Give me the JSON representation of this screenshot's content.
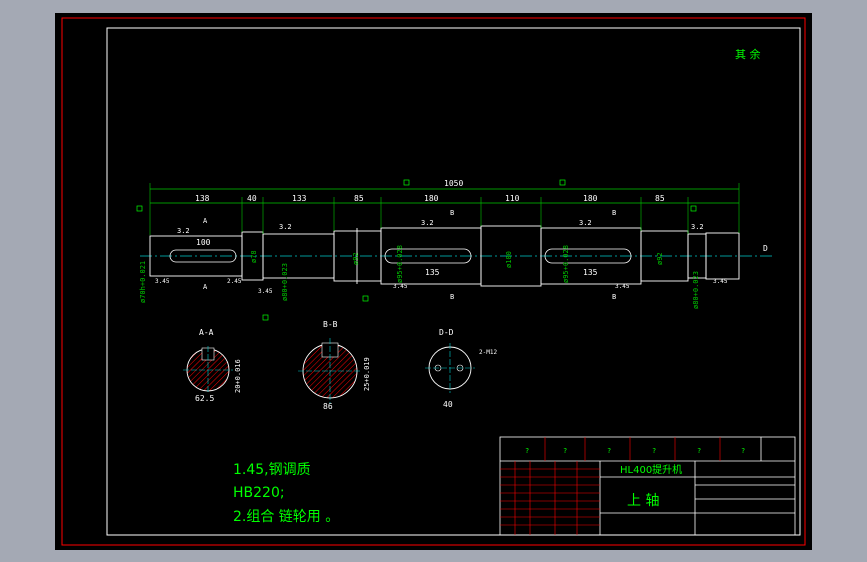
{
  "colors": {
    "background": "#000000",
    "frame": "#ff0000",
    "outline": "#ffffff",
    "dimension": "#00c800",
    "hatch": "#ff0000",
    "centerline": "#00cccc",
    "accent_text": "#00ff00",
    "title_text": "#00ff00"
  },
  "roughness_note": "其 余",
  "overall_length": "1050",
  "dims_top": [
    "138",
    "40",
    "133",
    "85",
    "180",
    "110",
    "180",
    "85"
  ],
  "keyway_lengths": [
    "100",
    "135",
    "135"
  ],
  "diameters": [
    "ø70h+0.021",
    "ø78",
    "ø80+0.023",
    "ø92",
    "ø95+0.028",
    "ø100",
    "ø95+0.028",
    "ø92",
    "ø80+0.023"
  ],
  "roughness_values": [
    "3.2",
    "3.2",
    "3.2",
    "3.2",
    "3.2"
  ],
  "chamfers": [
    "3.45",
    "2.45",
    "3.45",
    "3.45",
    "3.45",
    "3.45"
  ],
  "section_marks": [
    "A",
    "A",
    "B",
    "B",
    "B",
    "B"
  ],
  "sections": [
    {
      "title": "A-A",
      "width_dim": "62.5",
      "tol": "20+0.016"
    },
    {
      "title": "B-B",
      "width_dim": "86",
      "tol": "25+0.019"
    },
    {
      "title": "D-D",
      "width_dim": "40",
      "note": "2-M12"
    }
  ],
  "center_label": "D",
  "notes": [
    "1.45,钢调质",
    "HB220;",
    "2.组合 链轮用 。"
  ],
  "title_block": {
    "drawing_name": "HL400提升机",
    "part_name": "上   轴",
    "placeholders": [
      "?",
      "?",
      "?",
      "?",
      "?",
      "?"
    ]
  }
}
